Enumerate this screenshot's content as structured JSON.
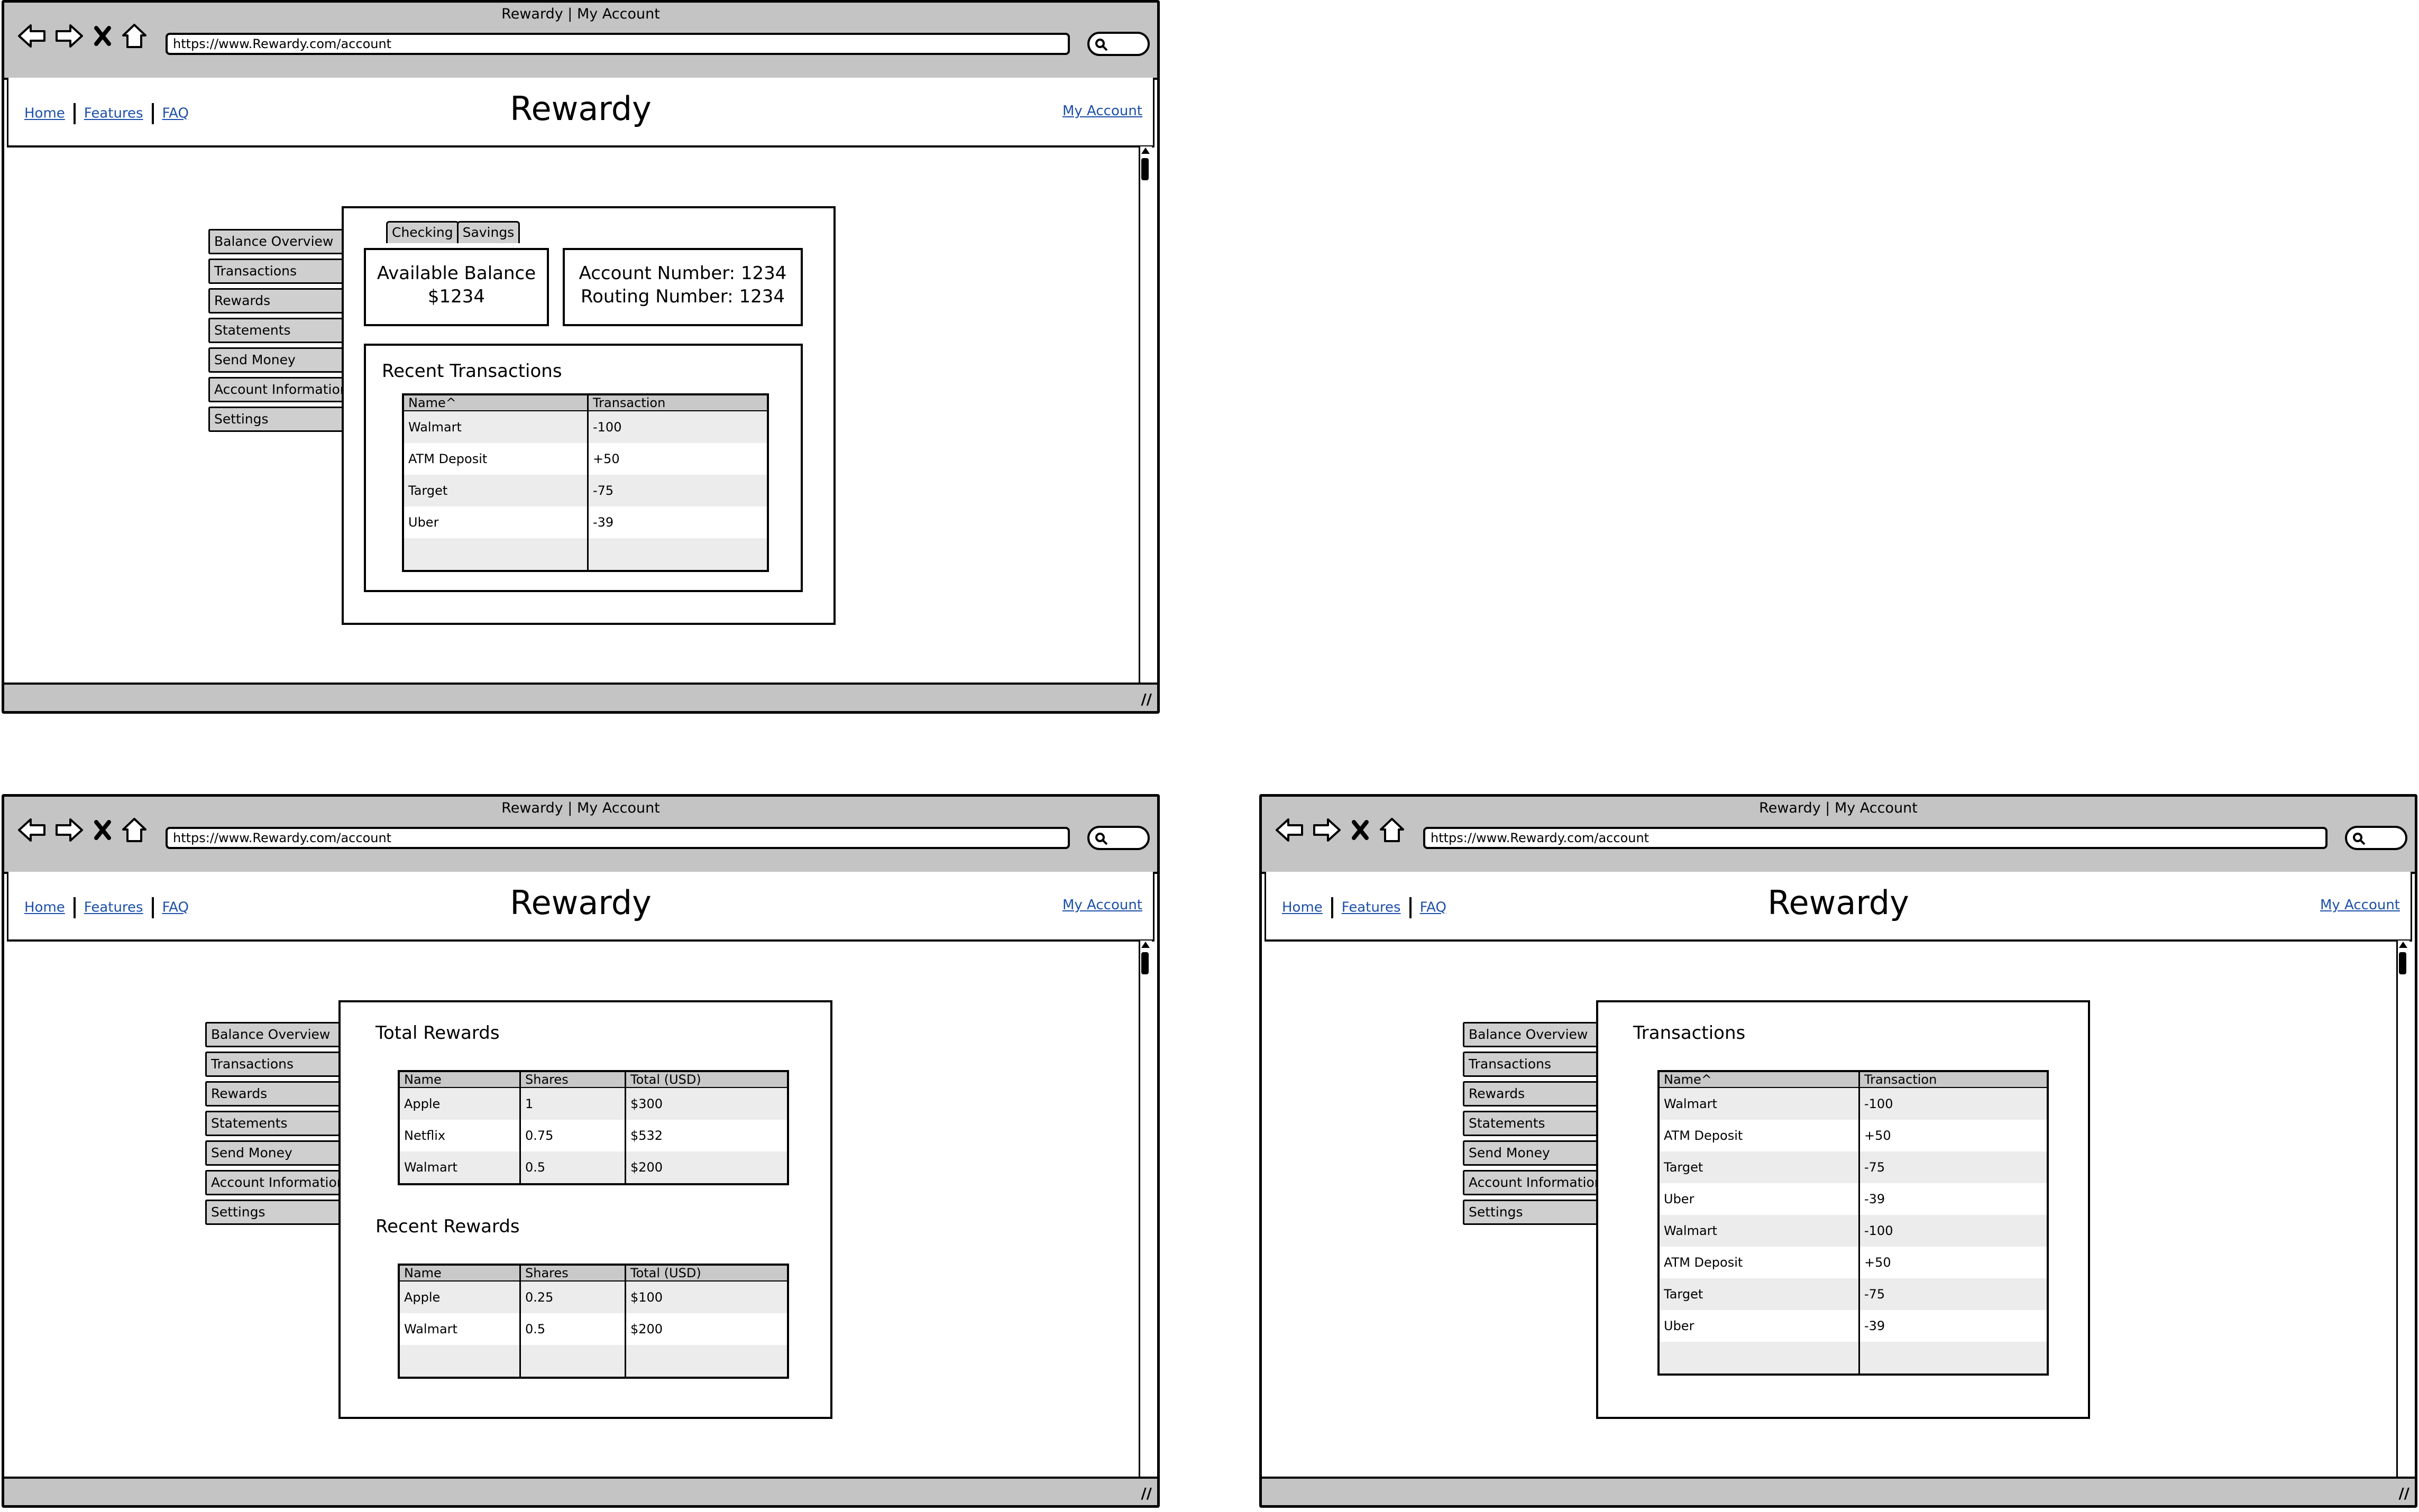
{
  "browser": {
    "window_title": "Rewardy | My Account",
    "url": "https://www.Rewardy.com/account"
  },
  "site": {
    "nav": [
      "Home",
      "Features",
      "FAQ"
    ],
    "brand": "Rewardy",
    "account_link": "My Account"
  },
  "sidebar": [
    "Balance Overview",
    "Transactions",
    "Rewards",
    "Statements",
    "Send Money",
    "Account Information",
    "Settings"
  ],
  "overview": {
    "tabs": [
      "Checking",
      "Savings"
    ],
    "balance_label": "Available Balance",
    "balance_value": "$1234",
    "account_number": "Account Number: 1234",
    "routing_number": "Routing Number: 1234",
    "recent_title": "Recent Transactions",
    "columns": [
      "Name^",
      "Transaction"
    ],
    "rows": [
      [
        "Walmart",
        "-100"
      ],
      [
        "ATM Deposit",
        "+50"
      ],
      [
        "Target",
        "-75"
      ],
      [
        "Uber",
        "-39"
      ],
      [
        "",
        ""
      ]
    ]
  },
  "rewards": {
    "total_title": "Total Rewards",
    "total_columns": [
      "Name",
      "Shares",
      "Total (USD)"
    ],
    "total_rows": [
      [
        "Apple",
        "1",
        "$300"
      ],
      [
        "Netflix",
        "0.75",
        "$532"
      ],
      [
        "Walmart",
        "0.5",
        "$200"
      ]
    ],
    "recent_title": "Recent Rewards",
    "recent_columns": [
      "Name",
      "Shares",
      "Total (USD)"
    ],
    "recent_rows": [
      [
        "Apple",
        "0.25",
        "$100"
      ],
      [
        "Walmart",
        "0.5",
        "$200"
      ],
      [
        "",
        "",
        ""
      ]
    ]
  },
  "transactions": {
    "title": "Transactions",
    "columns": [
      "Name^",
      "Transaction"
    ],
    "rows": [
      [
        "Walmart",
        "-100"
      ],
      [
        "ATM Deposit",
        "+50"
      ],
      [
        "Target",
        "-75"
      ],
      [
        "Uber",
        "-39"
      ],
      [
        "Walmart",
        "-100"
      ],
      [
        "ATM Deposit",
        "+50"
      ],
      [
        "Target",
        "-75"
      ],
      [
        "Uber",
        "-39"
      ],
      [
        "",
        ""
      ]
    ]
  }
}
